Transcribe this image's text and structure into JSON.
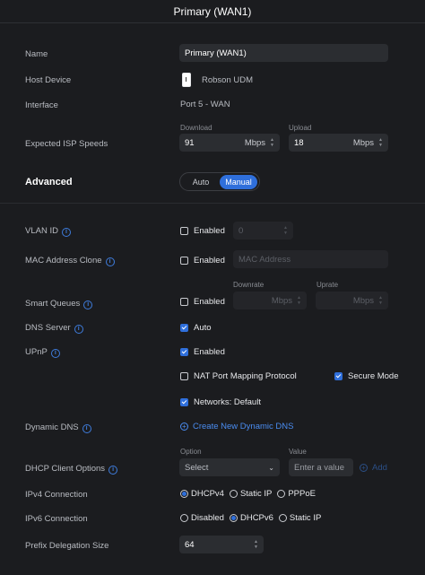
{
  "header": {
    "title": "Primary (WAN1)"
  },
  "labels": {
    "name": "Name",
    "host_device": "Host Device",
    "interface": "Interface",
    "expected_isp_speeds": "Expected ISP Speeds",
    "advanced": "Advanced",
    "vlan_id": "VLAN ID",
    "mac_address_clone": "MAC Address Clone",
    "smart_queues": "Smart Queues",
    "dns_server": "DNS Server",
    "upnp": "UPnP",
    "dynamic_dns": "Dynamic DNS",
    "dhcp_client_options": "DHCP Client Options",
    "ipv4_connection": "IPv4 Connection",
    "ipv6_connection": "IPv6 Connection",
    "prefix_delegation_size": "Prefix Delegation Size"
  },
  "name_field": {
    "value": "Primary (WAN1)"
  },
  "host_device": {
    "value": "Robson UDM",
    "icon": "device-icon"
  },
  "interface": {
    "value": "Port 5 - WAN"
  },
  "speeds": {
    "download_label": "Download",
    "download_value": "91",
    "download_unit": "Mbps",
    "upload_label": "Upload",
    "upload_value": "18",
    "upload_unit": "Mbps"
  },
  "mode_toggle": {
    "auto": "Auto",
    "manual": "Manual",
    "selected": "Manual"
  },
  "vlan": {
    "checkbox": "Enabled",
    "checked": false,
    "placeholder": "0"
  },
  "mac_clone": {
    "checkbox": "Enabled",
    "checked": false,
    "placeholder": "MAC Address"
  },
  "smart_queues": {
    "checkbox": "Enabled",
    "checked": false,
    "downrate_label": "Downrate",
    "downrate_unit": "Mbps",
    "uprate_label": "Uprate",
    "uprate_unit": "Mbps"
  },
  "dns_server": {
    "checkbox": "Auto",
    "checked": true
  },
  "upnp": {
    "enabled": "Enabled",
    "enabled_checked": true,
    "nat_pmp": "NAT Port Mapping Protocol",
    "nat_pmp_checked": false,
    "secure_mode": "Secure Mode",
    "secure_mode_checked": true,
    "networks": "Networks: Default",
    "networks_checked": true
  },
  "dynamic_dns": {
    "link": "Create New Dynamic DNS"
  },
  "dhcp_options": {
    "option_label": "Option",
    "select_value": "Select",
    "value_label": "Value",
    "value_placeholder": "Enter a value",
    "add": "Add"
  },
  "ipv4": {
    "options": [
      "DHCPv4",
      "Static IP",
      "PPPoE"
    ],
    "selected": "DHCPv4"
  },
  "ipv6": {
    "options": [
      "Disabled",
      "DHCPv6",
      "Static IP"
    ],
    "selected": "DHCPv6"
  },
  "prefix": {
    "value": "64"
  },
  "colors": {
    "accent": "#2f6fdb",
    "background": "#1b1c1f",
    "field": "#2b2d31",
    "link": "#4a8cf0"
  }
}
